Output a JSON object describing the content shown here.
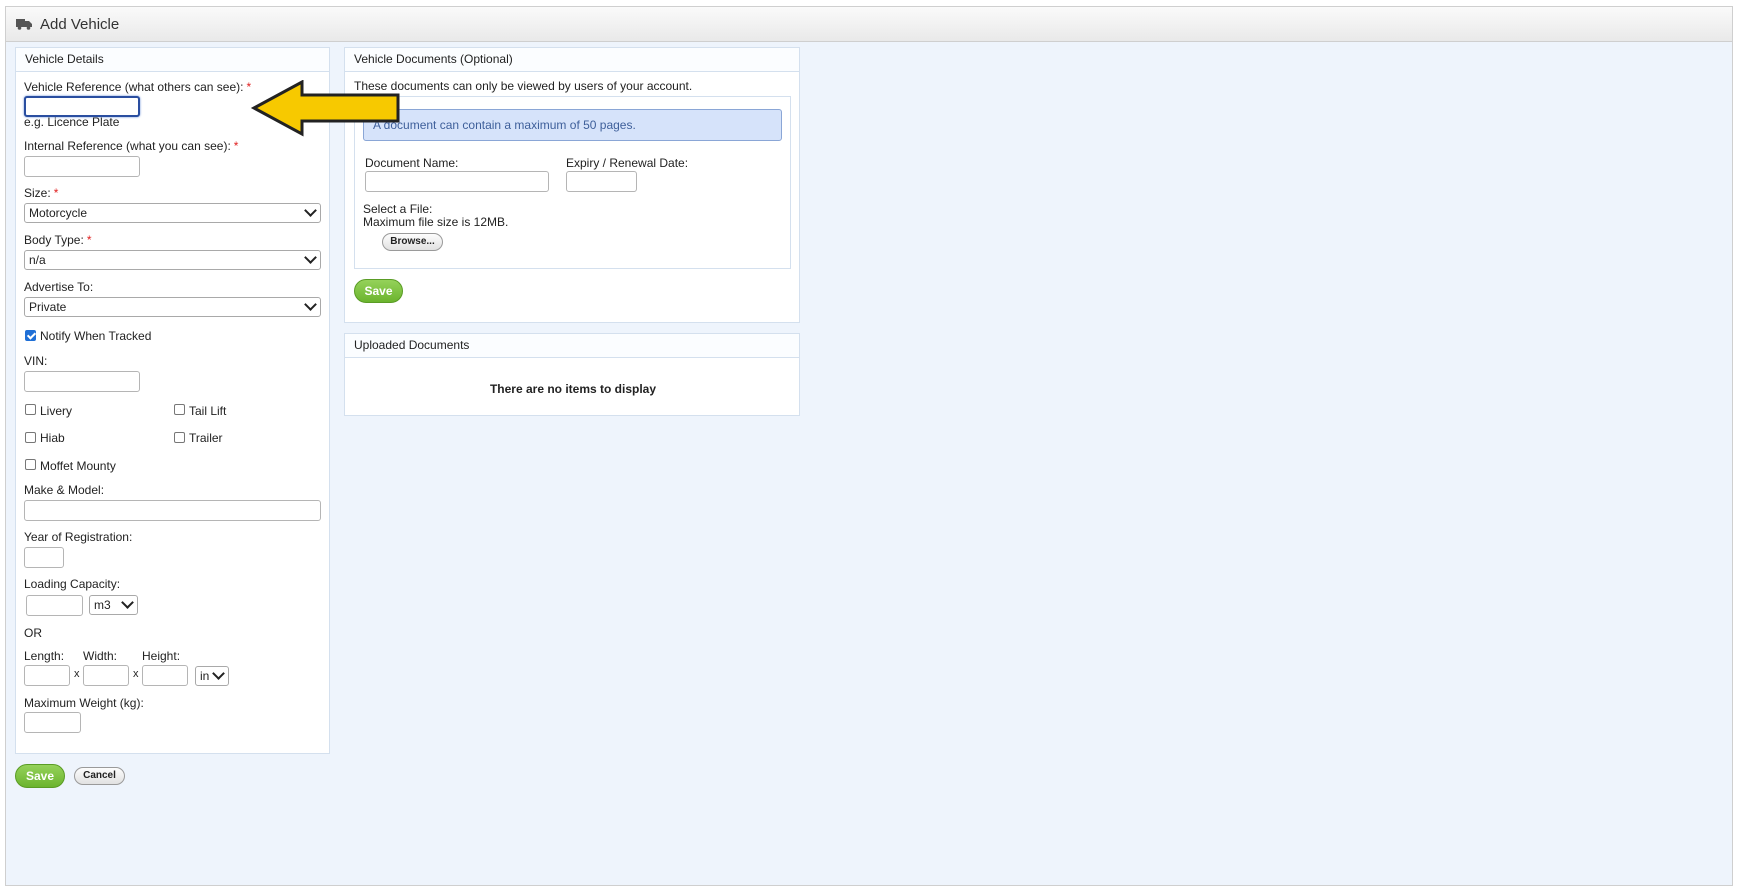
{
  "window": {
    "title": "Add Vehicle",
    "icon": "truck-icon"
  },
  "vehicle_details": {
    "header": "Vehicle Details",
    "vehicle_reference": {
      "label": "Vehicle Reference (what others can see):",
      "required": "*",
      "value": "",
      "hint": "e.g. Licence Plate"
    },
    "internal_reference": {
      "label": "Internal Reference (what you can see):",
      "required": "*",
      "value": ""
    },
    "size": {
      "label": "Size:",
      "required": "*",
      "selected": "Motorcycle"
    },
    "body_type": {
      "label": "Body Type:",
      "required": "*",
      "selected": "n/a"
    },
    "advertise_to": {
      "label": "Advertise To:",
      "selected": "Private"
    },
    "notify_when_tracked": {
      "label": "Notify When Tracked",
      "checked": true
    },
    "vin": {
      "label": "VIN:",
      "value": ""
    },
    "options": {
      "livery": {
        "label": "Livery",
        "checked": false
      },
      "tail_lift": {
        "label": "Tail Lift",
        "checked": false
      },
      "hiab": {
        "label": "Hiab",
        "checked": false
      },
      "trailer": {
        "label": "Trailer",
        "checked": false
      },
      "moffet_mounty": {
        "label": "Moffet Mounty",
        "checked": false
      }
    },
    "make_model": {
      "label": "Make & Model:",
      "value": ""
    },
    "year_of_registration": {
      "label": "Year of Registration:",
      "value": ""
    },
    "loading_capacity": {
      "label": "Loading Capacity:",
      "value": "",
      "unit": "m3"
    },
    "or_label": "OR",
    "dimensions": {
      "length_label": "Length:",
      "width_label": "Width:",
      "height_label": "Height:",
      "separator": "x",
      "unit": "in"
    },
    "max_weight": {
      "label": "Maximum Weight (kg):",
      "value": ""
    }
  },
  "vehicle_documents": {
    "header": "Vehicle Documents (Optional)",
    "info": "These documents can only be viewed by users of your account.",
    "notice": "A document can contain a maximum of 50 pages.",
    "document_name_label": "Document Name:",
    "expiry_label": "Expiry / Renewal Date:",
    "select_file_label": "Select a File:",
    "max_file_size": "Maximum file size is 12MB.",
    "browse_label": "Browse...",
    "save_label": "Save"
  },
  "uploaded_documents": {
    "header": "Uploaded Documents",
    "empty_message": "There are no items to display"
  },
  "footer": {
    "save_label": "Save",
    "cancel_label": "Cancel"
  },
  "colors": {
    "arrow_fill": "#f7c900",
    "arrow_stroke": "#222222",
    "accent_green": "#6bb42e",
    "required_red": "#e02020"
  }
}
